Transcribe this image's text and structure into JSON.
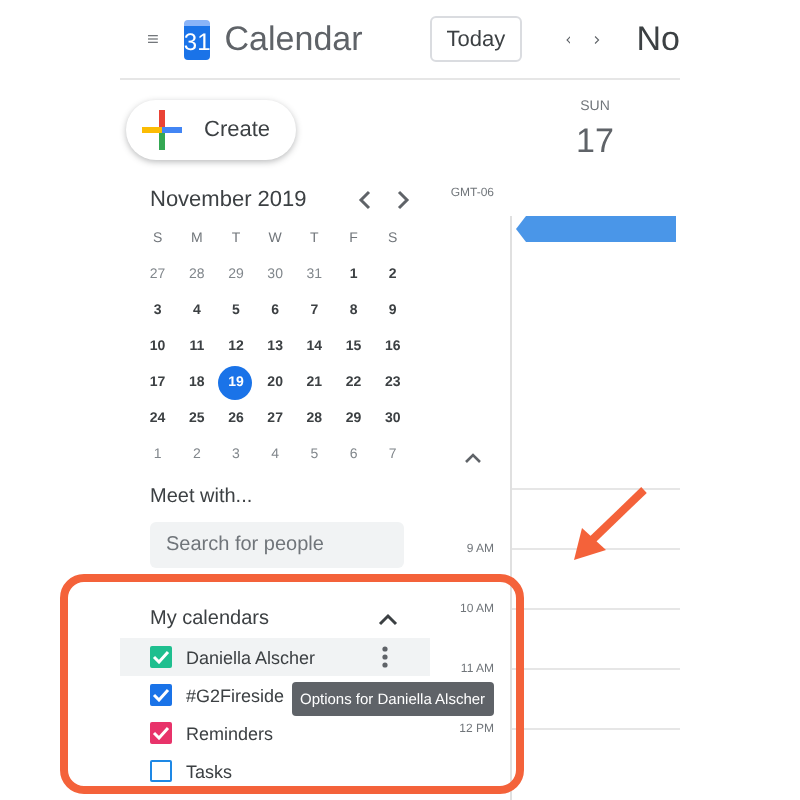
{
  "header": {
    "logo_day": "31",
    "app_title": "Calendar",
    "today_button": "Today",
    "month_label": "No"
  },
  "create_button": "Create",
  "day": {
    "weekday": "SUN",
    "date": "17"
  },
  "timezone": "GMT-06",
  "event_bar": {
    "color": "#4a96e8"
  },
  "hours": [
    "9 AM",
    "10 AM",
    "11 AM",
    "12 PM"
  ],
  "mini_calendar": {
    "title": "November 2019",
    "weekdays": [
      "S",
      "M",
      "T",
      "W",
      "T",
      "F",
      "S"
    ],
    "weeks": [
      [
        {
          "day": "27",
          "muted": true,
          "selected": false
        },
        {
          "day": "28",
          "muted": true,
          "selected": false
        },
        {
          "day": "29",
          "muted": true,
          "selected": false
        },
        {
          "day": "30",
          "muted": true,
          "selected": false
        },
        {
          "day": "31",
          "muted": true,
          "selected": false
        },
        {
          "day": "1",
          "muted": false,
          "selected": false
        },
        {
          "day": "2",
          "muted": false,
          "selected": false
        }
      ],
      [
        {
          "day": "3",
          "muted": false,
          "selected": false
        },
        {
          "day": "4",
          "muted": false,
          "selected": false
        },
        {
          "day": "5",
          "muted": false,
          "selected": false
        },
        {
          "day": "6",
          "muted": false,
          "selected": false
        },
        {
          "day": "7",
          "muted": false,
          "selected": false
        },
        {
          "day": "8",
          "muted": false,
          "selected": false
        },
        {
          "day": "9",
          "muted": false,
          "selected": false
        }
      ],
      [
        {
          "day": "10",
          "muted": false,
          "selected": false
        },
        {
          "day": "11",
          "muted": false,
          "selected": false
        },
        {
          "day": "12",
          "muted": false,
          "selected": false
        },
        {
          "day": "13",
          "muted": false,
          "selected": false
        },
        {
          "day": "14",
          "muted": false,
          "selected": false
        },
        {
          "day": "15",
          "muted": false,
          "selected": false
        },
        {
          "day": "16",
          "muted": false,
          "selected": false
        }
      ],
      [
        {
          "day": "17",
          "muted": false,
          "selected": false
        },
        {
          "day": "18",
          "muted": false,
          "selected": false
        },
        {
          "day": "19",
          "muted": false,
          "selected": true
        },
        {
          "day": "20",
          "muted": false,
          "selected": false
        },
        {
          "day": "21",
          "muted": false,
          "selected": false
        },
        {
          "day": "22",
          "muted": false,
          "selected": false
        },
        {
          "day": "23",
          "muted": false,
          "selected": false
        }
      ],
      [
        {
          "day": "24",
          "muted": false,
          "selected": false
        },
        {
          "day": "25",
          "muted": false,
          "selected": false
        },
        {
          "day": "26",
          "muted": false,
          "selected": false
        },
        {
          "day": "27",
          "muted": false,
          "selected": false
        },
        {
          "day": "28",
          "muted": false,
          "selected": false
        },
        {
          "day": "29",
          "muted": false,
          "selected": false
        },
        {
          "day": "30",
          "muted": false,
          "selected": false
        }
      ],
      [
        {
          "day": "1",
          "muted": true,
          "selected": false
        },
        {
          "day": "2",
          "muted": true,
          "selected": false
        },
        {
          "day": "3",
          "muted": true,
          "selected": false
        },
        {
          "day": "4",
          "muted": true,
          "selected": false
        },
        {
          "day": "5",
          "muted": true,
          "selected": false
        },
        {
          "day": "6",
          "muted": true,
          "selected": false
        },
        {
          "day": "7",
          "muted": true,
          "selected": false
        }
      ]
    ]
  },
  "meet_with": {
    "title": "Meet with...",
    "placeholder": "Search for people"
  },
  "my_calendars": {
    "title": "My calendars",
    "expanded": true,
    "items": [
      {
        "name": "Daniella Alscher",
        "color": "#1fbf8f",
        "checked": true,
        "hovered": true
      },
      {
        "name": "#G2Fireside",
        "color": "#1a73e8",
        "checked": true,
        "hovered": false
      },
      {
        "name": "Reminders",
        "color": "#e8336a",
        "checked": true,
        "hovered": false
      },
      {
        "name": "Tasks",
        "color": "#1e88e5",
        "checked": false,
        "hovered": false
      }
    ]
  },
  "tooltip": "Options for Daniella Alscher"
}
